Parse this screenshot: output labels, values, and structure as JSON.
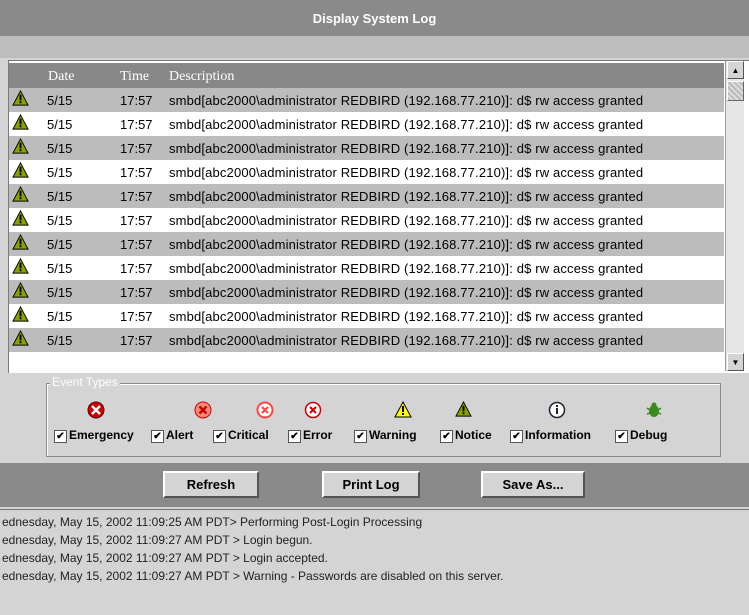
{
  "window": {
    "title": "Display System Log"
  },
  "log": {
    "columns": {
      "date": "Date",
      "time": "Time",
      "description": "Description"
    },
    "rows": [
      {
        "date": "5/15",
        "time": "17:57",
        "desc": "smbd[abc2000\\administrator REDBIRD (192.168.77.210)]: d$ rw access granted",
        "icon": "notice-icon"
      },
      {
        "date": "5/15",
        "time": "17:57",
        "desc": "smbd[abc2000\\administrator REDBIRD (192.168.77.210)]: d$ rw access granted",
        "icon": "notice-icon"
      },
      {
        "date": "5/15",
        "time": "17:57",
        "desc": "smbd[abc2000\\administrator REDBIRD (192.168.77.210)]: d$ rw access granted",
        "icon": "notice-icon"
      },
      {
        "date": "5/15",
        "time": "17:57",
        "desc": "smbd[abc2000\\administrator REDBIRD (192.168.77.210)]: d$ rw access granted",
        "icon": "notice-icon"
      },
      {
        "date": "5/15",
        "time": "17:57",
        "desc": "smbd[abc2000\\administrator REDBIRD (192.168.77.210)]: d$ rw access granted",
        "icon": "notice-icon"
      },
      {
        "date": "5/15",
        "time": "17:57",
        "desc": "smbd[abc2000\\administrator REDBIRD (192.168.77.210)]: d$ rw access granted",
        "icon": "notice-icon"
      },
      {
        "date": "5/15",
        "time": "17:57",
        "desc": "smbd[abc2000\\administrator REDBIRD (192.168.77.210)]: d$ rw access granted",
        "icon": "notice-icon"
      },
      {
        "date": "5/15",
        "time": "17:57",
        "desc": "smbd[abc2000\\administrator REDBIRD (192.168.77.210)]: d$ rw access granted",
        "icon": "notice-icon"
      },
      {
        "date": "5/15",
        "time": "17:57",
        "desc": "smbd[abc2000\\administrator REDBIRD (192.168.77.210)]: d$ rw access granted",
        "icon": "notice-icon"
      },
      {
        "date": "5/15",
        "time": "17:57",
        "desc": "smbd[abc2000\\administrator REDBIRD (192.168.77.210)]: d$ rw access granted",
        "icon": "notice-icon"
      },
      {
        "date": "5/15",
        "time": "17:57",
        "desc": "smbd[abc2000\\administrator REDBIRD (192.168.77.210)]: d$ rw access granted",
        "icon": "notice-icon"
      }
    ]
  },
  "event_types": {
    "legend": "Event Types",
    "items": [
      {
        "label": "Emergency",
        "icon": "emergency-icon",
        "checked": true
      },
      {
        "label": "Alert",
        "icon": "alert-icon",
        "checked": true
      },
      {
        "label": "Critical",
        "icon": "critical-icon",
        "checked": true
      },
      {
        "label": "Error",
        "icon": "error-icon",
        "checked": true
      },
      {
        "label": "Warning",
        "icon": "warning-icon",
        "checked": true
      },
      {
        "label": "Notice",
        "icon": "notice-icon",
        "checked": true
      },
      {
        "label": "Information",
        "icon": "information-icon",
        "checked": true
      },
      {
        "label": "Debug",
        "icon": "debug-icon",
        "checked": true
      }
    ]
  },
  "buttons": {
    "refresh": "Refresh",
    "print": "Print Log",
    "save": "Save As..."
  },
  "console": [
    "ednesday, May 15, 2002 11:09:25 AM PDT> Performing Post-Login Processing",
    "ednesday, May 15, 2002 11:09:27 AM PDT > Login begun.",
    "ednesday, May 15, 2002 11:09:27 AM PDT > Login accepted.",
    "ednesday, May 15, 2002 11:09:27 AM PDT > Warning - Passwords are disabled on this server."
  ],
  "colors": {
    "emergency": "#cc0000",
    "alert": "#ff3333",
    "critical": "#ff4444",
    "warning": "#ffff00",
    "notice": "#8aa000",
    "debug": "#3c8a1e"
  }
}
